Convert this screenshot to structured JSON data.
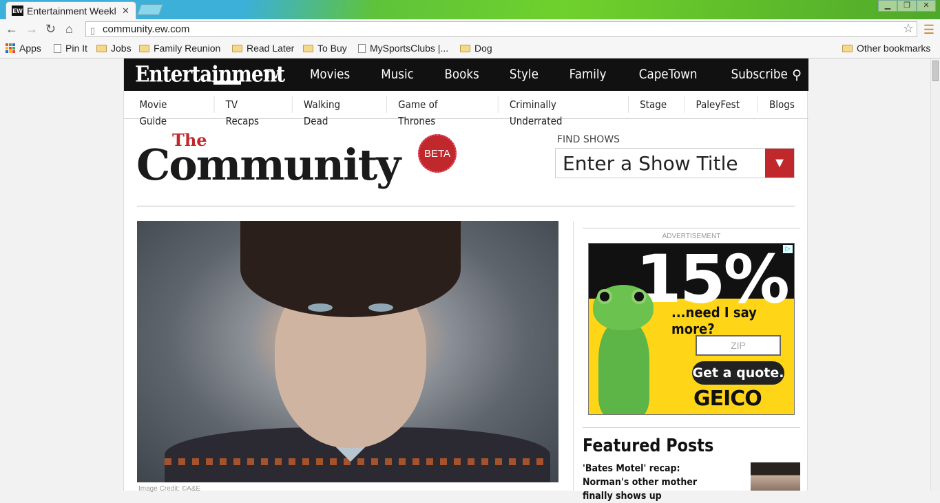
{
  "browser": {
    "tab_title": "Entertainment Weekl",
    "tab_favicon": "EW",
    "url": "community.ew.com",
    "bookmarks": [
      {
        "label": "Apps",
        "icon": "apps-icon"
      },
      {
        "label": "Pin It",
        "icon": "page-icon"
      },
      {
        "label": "Jobs",
        "icon": "folder-icon"
      },
      {
        "label": "Family Reunion",
        "icon": "folder-icon"
      },
      {
        "label": "Read Later",
        "icon": "folder-icon"
      },
      {
        "label": "To Buy",
        "icon": "folder-icon"
      },
      {
        "label": "MySportsClubs |...",
        "icon": "page-icon"
      },
      {
        "label": "Dog",
        "icon": "folder-icon"
      }
    ],
    "other_bookmarks": "Other bookmarks"
  },
  "site": {
    "logo": "Entertainment",
    "nav": [
      "TV",
      "Movies",
      "Music",
      "Books",
      "Style",
      "Family",
      "CapeTown",
      "Subscribe"
    ],
    "subnav": [
      "Movie Guide",
      "TV Recaps",
      "Walking Dead",
      "Game of Thrones",
      "Criminally Underrated",
      "Stage",
      "PaleyFest",
      "Blogs"
    ]
  },
  "community": {
    "the": "The",
    "title": "Community",
    "badge": "BETA",
    "find_label": "FIND SHOWS",
    "find_placeholder": "Enter a Show Title"
  },
  "hero": {
    "caption": "Image Credit: ©A&E"
  },
  "sidebar": {
    "ad_label": "ADVERTISEMENT",
    "ad": {
      "headline": "15%",
      "tagline": "...need I say more?",
      "zip_placeholder": "ZIP",
      "cta": "Get a quote.",
      "brand": "GEICO"
    },
    "featured_title": "Featured Posts",
    "featured_posts": [
      {
        "title": "'Bates Motel' recap: Norman's other mother finally shows up"
      }
    ]
  },
  "colors": {
    "accent_red": "#c0282b",
    "nav_black": "#111111",
    "ad_yellow": "#ffd518"
  }
}
